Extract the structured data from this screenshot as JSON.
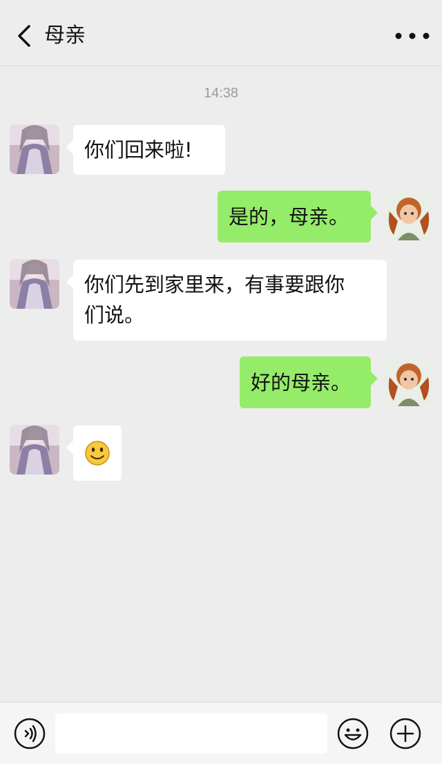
{
  "header": {
    "title": "母亲",
    "back_icon": "chevron-left-icon",
    "more_icon": "more-dots-icon"
  },
  "chat": {
    "timestamp": "14:38",
    "messages": [
      {
        "side": "left",
        "text": "你们回来啦!"
      },
      {
        "side": "right",
        "text": "是的，母亲。"
      },
      {
        "side": "left",
        "text_line1": "你们先到家里来，有事要跟你",
        "text_line2": "们说。"
      },
      {
        "side": "right",
        "text": "好的母亲。"
      },
      {
        "side": "left",
        "emoji": "smiley-emoji-icon"
      }
    ]
  },
  "inputbar": {
    "voice_icon": "voice-icon",
    "emoji_icon": "emoji-icon",
    "plus_icon": "plus-icon",
    "input_value": ""
  },
  "colors": {
    "background": "#ededed",
    "bubble_sent": "#95ec69",
    "bubble_received": "#ffffff"
  }
}
